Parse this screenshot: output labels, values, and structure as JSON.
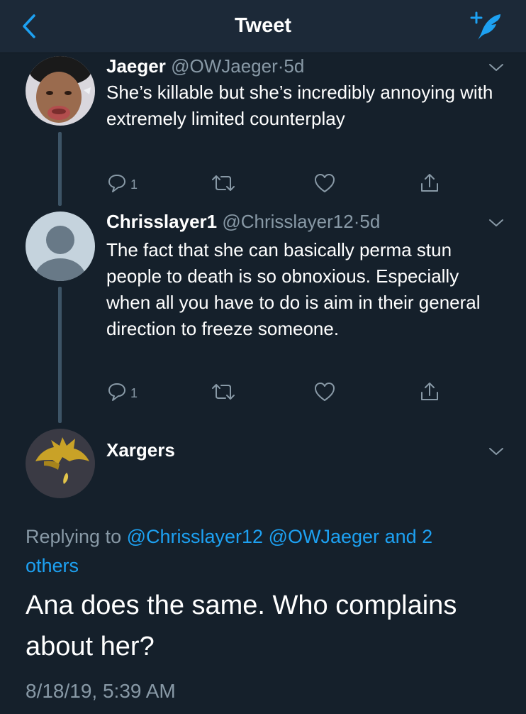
{
  "nav": {
    "title": "Tweet",
    "back_icon": "chevron-left-icon",
    "compose_icon": "compose-tweet-icon"
  },
  "colors": {
    "background": "#15202b",
    "navbar": "#1c2938",
    "accent": "#1da1f2",
    "secondary_text": "#8899a6"
  },
  "tweets": [
    {
      "name": "Jaeger",
      "handle": "@OWJaeger",
      "separator": "·",
      "time": "5d",
      "text": "She’s killable but she’s incredibly annoying with extremely limited counterplay",
      "reply_count": "1"
    },
    {
      "name": "Chrisslayer1",
      "handle": "@Chrisslayer12",
      "separator": "·",
      "time": "5d",
      "text": "The fact that she can basically perma stun people to death is so obnoxious. Especially when all you have to do is aim in their general direction to freeze someone.",
      "reply_count": "1"
    }
  ],
  "main_tweet": {
    "name": "Xargers",
    "replying_prefix": "Replying to",
    "mention_1": "@Chrisslayer12",
    "mention_2": "@OWJaeger",
    "and_others": "and 2 others",
    "text": "Ana does the same. Who complains about her?",
    "timestamp": "8/18/19, 5:39 AM"
  }
}
